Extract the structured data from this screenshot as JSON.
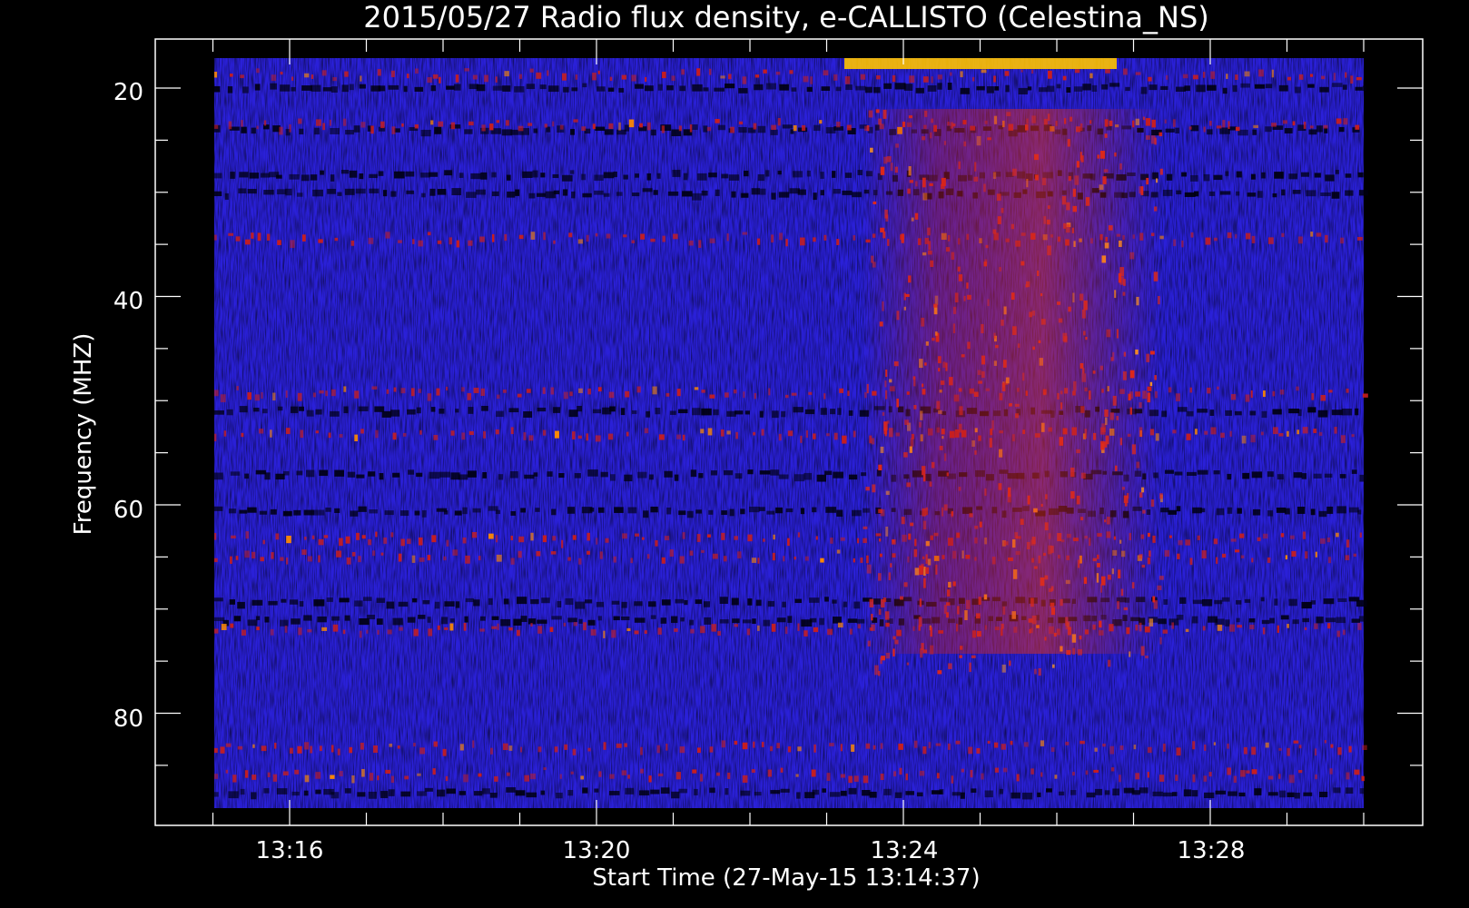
{
  "chart_data": {
    "type": "heatmap",
    "title": "2015/05/27  Radio flux density, e-CALLISTO (Celestina_NS)",
    "xlabel": "Start Time (27-May-15 13:14:37)",
    "ylabel": "Frequency (MHZ)",
    "x_ticks": [
      "13:16",
      "13:20",
      "13:24",
      "13:28"
    ],
    "y_ticks": [
      "20",
      "40",
      "60",
      "80"
    ],
    "x_range": [
      "13:14:37",
      "13:30"
    ],
    "y_range": [
      17,
      89
    ],
    "y_axis_inverted": true,
    "colormap": [
      "#000000",
      "#1a1aa0",
      "#3a2ee6",
      "#6a1e9a",
      "#c81e1e",
      "#ff6a00",
      "#ffe600"
    ],
    "features": [
      {
        "name": "bright band",
        "freq_mhz": [
          17,
          20
        ],
        "time": [
          "13:23",
          "13:27"
        ]
      },
      {
        "name": "burst emission",
        "freq_mhz": [
          25,
          75
        ],
        "time": [
          "13:23",
          "13:27"
        ]
      }
    ],
    "grid": false
  }
}
